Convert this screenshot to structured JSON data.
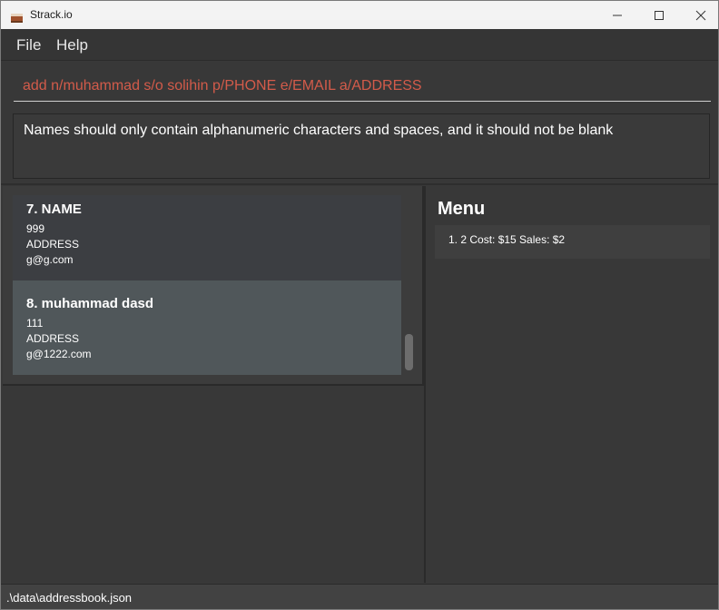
{
  "window": {
    "title": "Strack.io",
    "app_icon": "cake-icon",
    "controls": [
      "minimize-icon",
      "maximize-icon",
      "close-icon"
    ]
  },
  "menubar": {
    "file": "File",
    "help": "Help"
  },
  "command": {
    "value": "add n/muhammad s/o solihin p/PHONE e/EMAIL a/ADDRESS",
    "color": "#d35b4a"
  },
  "result": {
    "message": "Names should only contain alphanumeric characters and spaces, and it should not be blank"
  },
  "persons": [
    {
      "name": "7.  NAME",
      "phone": "999",
      "address": "ADDRESS",
      "email": "g@g.com"
    },
    {
      "name": "8.  muhammad dasd",
      "phone": "111",
      "address": "ADDRESS",
      "email": "g@1222.com"
    }
  ],
  "menu_panel": {
    "title": "Menu",
    "items": [
      "1. 2  Cost: $15  Sales: $2"
    ]
  },
  "status": {
    "path": ".\\data\\addressbook.json"
  },
  "colors": {
    "selected_card": "#50575a",
    "background": "#383838"
  }
}
